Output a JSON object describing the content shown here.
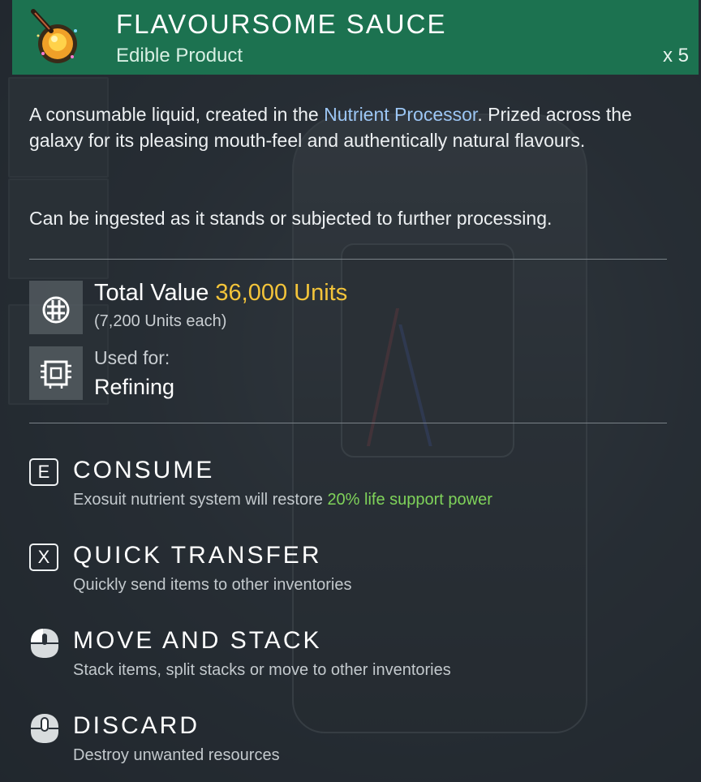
{
  "header": {
    "title": "FLAVOURSOME SAUCE",
    "subtitle": "Edible Product",
    "count": "x 5",
    "icon": "sauce-pan-icon",
    "color": "#1c7250"
  },
  "description": {
    "part1": "A consumable liquid, created in the ",
    "highlight": "Nutrient Processor",
    "part2": ". Prized across the galaxy for its pleasing mouth-feel and authentically natural flavours.",
    "second": "Can be ingested as it stands or subjected to further processing.",
    "highlight_color": "#9cc6f4"
  },
  "stats": {
    "value_label": "Total Value",
    "value_amount": "36,000 Units",
    "value_each": "(7,200 Units each)",
    "value_icon": "units-currency-icon",
    "used_for_label": "Used for:",
    "used_for_value": "Refining",
    "used_for_icon": "refiner-chip-icon",
    "gold_color": "#f3c43a"
  },
  "actions": [
    {
      "key": "E",
      "title": "CONSUME",
      "desc_prefix": "Exosuit nutrient system will restore ",
      "desc_highlight": "20% life support power",
      "icon": "key-e-icon"
    },
    {
      "key": "X",
      "title": "QUICK TRANSFER",
      "desc_prefix": "Quickly send items to other inventories",
      "icon": "key-x-icon"
    },
    {
      "title": "MOVE AND STACK",
      "desc_prefix": "Stack items, split stacks or move to other inventories",
      "icon": "mouse-left-click-icon"
    },
    {
      "title": "DISCARD",
      "desc_prefix": "Destroy unwanted resources",
      "icon": "mouse-middle-click-icon"
    }
  ]
}
